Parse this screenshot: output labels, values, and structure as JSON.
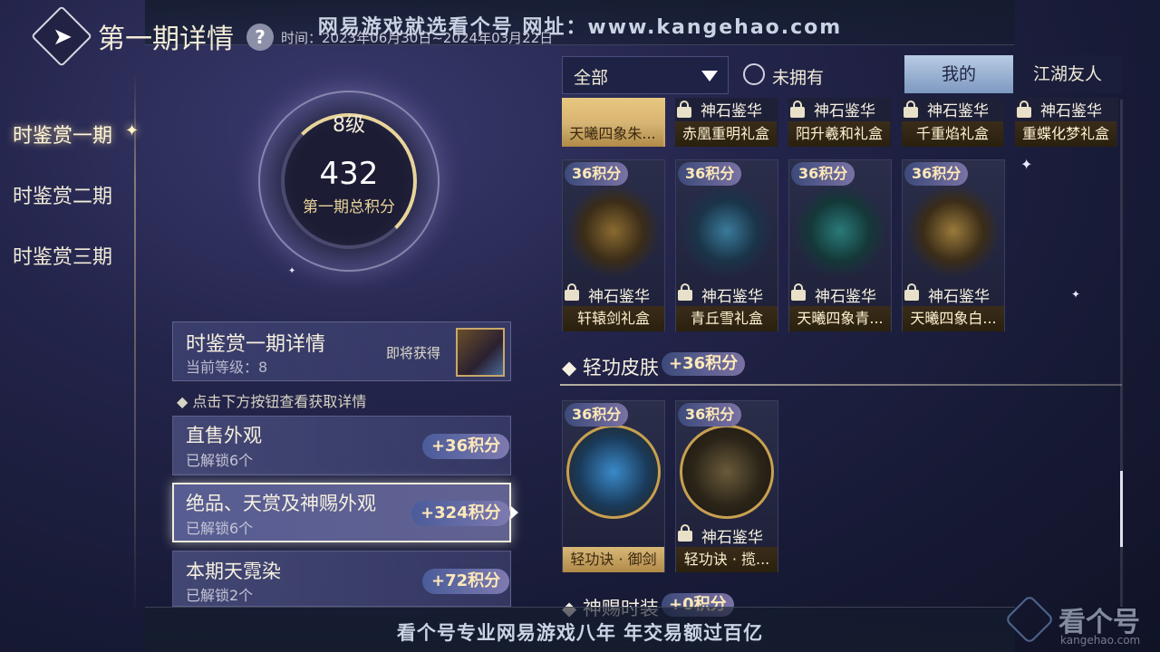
{
  "header": {
    "title": "第一期详情",
    "time": "时间：2023年06月30日~2024年03月22日",
    "banner": "网易游戏就选看个号  网址：www.kangehao.com"
  },
  "sidebar": {
    "items": [
      {
        "label": "时鉴赏一期"
      },
      {
        "label": "时鉴赏二期"
      },
      {
        "label": "时鉴赏三期"
      }
    ]
  },
  "level": {
    "level_label": "8级",
    "score": "432",
    "score_label": "第一期总积分",
    "progress_fraction": 0.25
  },
  "detail": {
    "title": "时鉴赏一期详情",
    "current_level": "当前等级：8",
    "upcoming": "即将获得",
    "hint": "◆ 点击下方按钮查看获取详情"
  },
  "categories": [
    {
      "title": "直售外观",
      "unlocked": "已解锁6个",
      "points": "+36积分"
    },
    {
      "title": "绝品、天赏及神赐外观",
      "unlocked": "已解锁6个",
      "points": "+324积分"
    },
    {
      "title": "本期天霓染",
      "unlocked": "已解锁2个",
      "points": "+72积分"
    }
  ],
  "filters": {
    "select_value": "全部",
    "radio_label": "未拥有",
    "tab_mine": "我的",
    "tab_friends": "江湖友人"
  },
  "top_row": [
    {
      "tag": "",
      "name": "天曦四象朱..."
    },
    {
      "tag": "神石鉴华",
      "name": "赤凰重明礼盒"
    },
    {
      "tag": "神石鉴华",
      "name": "阳升羲和礼盒"
    },
    {
      "tag": "神石鉴华",
      "name": "千重焰礼盒"
    },
    {
      "tag": "神石鉴华",
      "name": "重蝶化梦礼盒"
    }
  ],
  "mid_row": [
    {
      "badge": "36积分",
      "tag": "神石鉴华",
      "name": "轩辕剑礼盒"
    },
    {
      "badge": "36积分",
      "tag": "神石鉴华",
      "name": "青丘雪礼盒"
    },
    {
      "badge": "36积分",
      "tag": "神石鉴华",
      "name": "天曦四象青..."
    },
    {
      "badge": "36积分",
      "tag": "神石鉴华",
      "name": "天曦四象白..."
    }
  ],
  "section_qinggong": {
    "title": "◆ 轻功皮肤",
    "points": "+36积分"
  },
  "qinggong_row": [
    {
      "badge": "36积分",
      "tag": "",
      "name": "轻功诀 · 御剑"
    },
    {
      "badge": "36积分",
      "tag": "神石鉴华",
      "name": "轻功诀 · 揽..."
    }
  ],
  "section_shenci": {
    "title": "◆ 神赐时装",
    "points": "+0积分"
  },
  "footer": {
    "banner": "看个号专业网易游戏八年   年交易额过百亿"
  },
  "watermark": {
    "text": "看个号",
    "sub": "kangehao.com"
  },
  "colors": {
    "accent_gold": "#e8d49a",
    "points_text": "#ffe9b8",
    "tab_active": "#b8cce4"
  },
  "icons": [
    "back-icon",
    "help-icon",
    "dropdown-arrow-icon",
    "lock-icon",
    "sparkle-icon"
  ]
}
